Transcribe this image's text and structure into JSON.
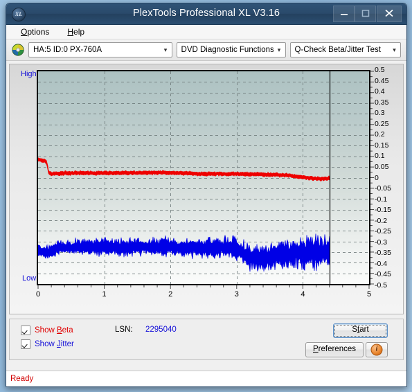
{
  "window": {
    "title": "PlexTools Professional XL V3.16",
    "icon_name": "xl-app-icon",
    "icon_text": "XL",
    "buttons": {
      "minimize": "minimize-icon",
      "maximize": "maximize-icon",
      "close": "close-icon"
    }
  },
  "menubar": {
    "items": [
      {
        "label": "Options",
        "mnemonic": "O"
      },
      {
        "label": "Help",
        "mnemonic": "H"
      }
    ]
  },
  "toolbar": {
    "disc_icon": "optical-disc-icon",
    "drive_select": {
      "value": "HA:5 ID:0  PX-760A",
      "arrow": "chevron-down-icon"
    },
    "function_select": {
      "value": "DVD Diagnostic Functions",
      "arrow": "chevron-down-icon"
    },
    "test_select": {
      "value": "Q-Check Beta/Jitter Test",
      "arrow": "chevron-down-icon"
    }
  },
  "chart_data": {
    "type": "line",
    "title": "Q-Check Beta/Jitter Test",
    "xlabel": "",
    "ylabel": "",
    "xlim": [
      0,
      5
    ],
    "ylim": [
      -0.5,
      0.5
    ],
    "grid": true,
    "legend_position": "bottom-left",
    "x_ticks": [
      "0",
      "1",
      "2",
      "3",
      "4",
      "5"
    ],
    "y_ticks": [
      "0.5",
      "0.45",
      "0.4",
      "0.35",
      "0.3",
      "0.25",
      "0.2",
      "0.15",
      "0.1",
      "0.05",
      "0",
      "-0.05",
      "-0.1",
      "-0.15",
      "-0.2",
      "-0.25",
      "-0.3",
      "-0.35",
      "-0.4",
      "-0.45",
      "-0.5"
    ],
    "axis_high_label": "High",
    "axis_low_label": "Low",
    "data_end_x": 4.4,
    "series": [
      {
        "name": "Beta",
        "color": "#ee0000",
        "x": [
          0.0,
          0.03,
          0.06,
          0.09,
          0.12,
          0.14,
          0.16,
          0.2,
          0.3,
          0.45,
          0.6,
          0.8,
          1.0,
          1.2,
          1.4,
          1.6,
          1.8,
          2.0,
          2.2,
          2.4,
          2.6,
          2.8,
          3.0,
          3.2,
          3.4,
          3.6,
          3.8,
          4.0,
          4.1,
          4.2,
          4.3,
          4.4
        ],
        "values": [
          0.085,
          0.082,
          0.08,
          0.079,
          0.078,
          0.06,
          0.022,
          0.018,
          0.02,
          0.022,
          0.022,
          0.021,
          0.022,
          0.022,
          0.023,
          0.023,
          0.024,
          0.023,
          0.021,
          0.019,
          0.018,
          0.018,
          0.017,
          0.016,
          0.015,
          0.013,
          0.01,
          0.002,
          -0.002,
          -0.005,
          -0.006,
          -0.003
        ],
        "band": 0.006
      },
      {
        "name": "Jitter",
        "color": "#0000e6",
        "x": [
          0.0,
          0.05,
          0.1,
          0.15,
          0.2,
          0.3,
          0.4,
          0.6,
          0.8,
          1.0,
          1.2,
          1.4,
          1.6,
          1.8,
          2.0,
          2.2,
          2.4,
          2.6,
          2.8,
          2.95,
          3.05,
          3.15,
          3.3,
          3.45,
          3.55,
          3.7,
          3.85,
          4.0,
          4.15,
          4.3,
          4.4
        ],
        "values": [
          -0.335,
          -0.345,
          -0.35,
          -0.352,
          -0.34,
          -0.33,
          -0.328,
          -0.326,
          -0.325,
          -0.326,
          -0.328,
          -0.327,
          -0.326,
          -0.325,
          -0.326,
          -0.328,
          -0.33,
          -0.329,
          -0.328,
          -0.33,
          -0.34,
          -0.37,
          -0.382,
          -0.378,
          -0.368,
          -0.362,
          -0.358,
          -0.352,
          -0.35,
          -0.348,
          -0.35
        ],
        "band_start": 0.022,
        "band_end": 0.05
      }
    ]
  },
  "controls": {
    "show_beta": {
      "label_prefix": "Show ",
      "label_mnemonic": "B",
      "label_suffix": "eta",
      "checked": true
    },
    "show_jitter": {
      "label_prefix": "Show ",
      "label_mnemonic": "J",
      "label_suffix": "itter",
      "checked": true
    },
    "lsn_label": "LSN:",
    "lsn_value": "2295040",
    "start_button": {
      "prefix": "S",
      "mnemonic": "t",
      "suffix": "art",
      "label": "Start"
    },
    "preferences_button": {
      "mnemonic": "P",
      "suffix": "references",
      "label": "Preferences"
    },
    "info_button": {
      "icon": "info-icon",
      "glyph": "i"
    }
  },
  "statusbar": {
    "text": "Ready"
  }
}
